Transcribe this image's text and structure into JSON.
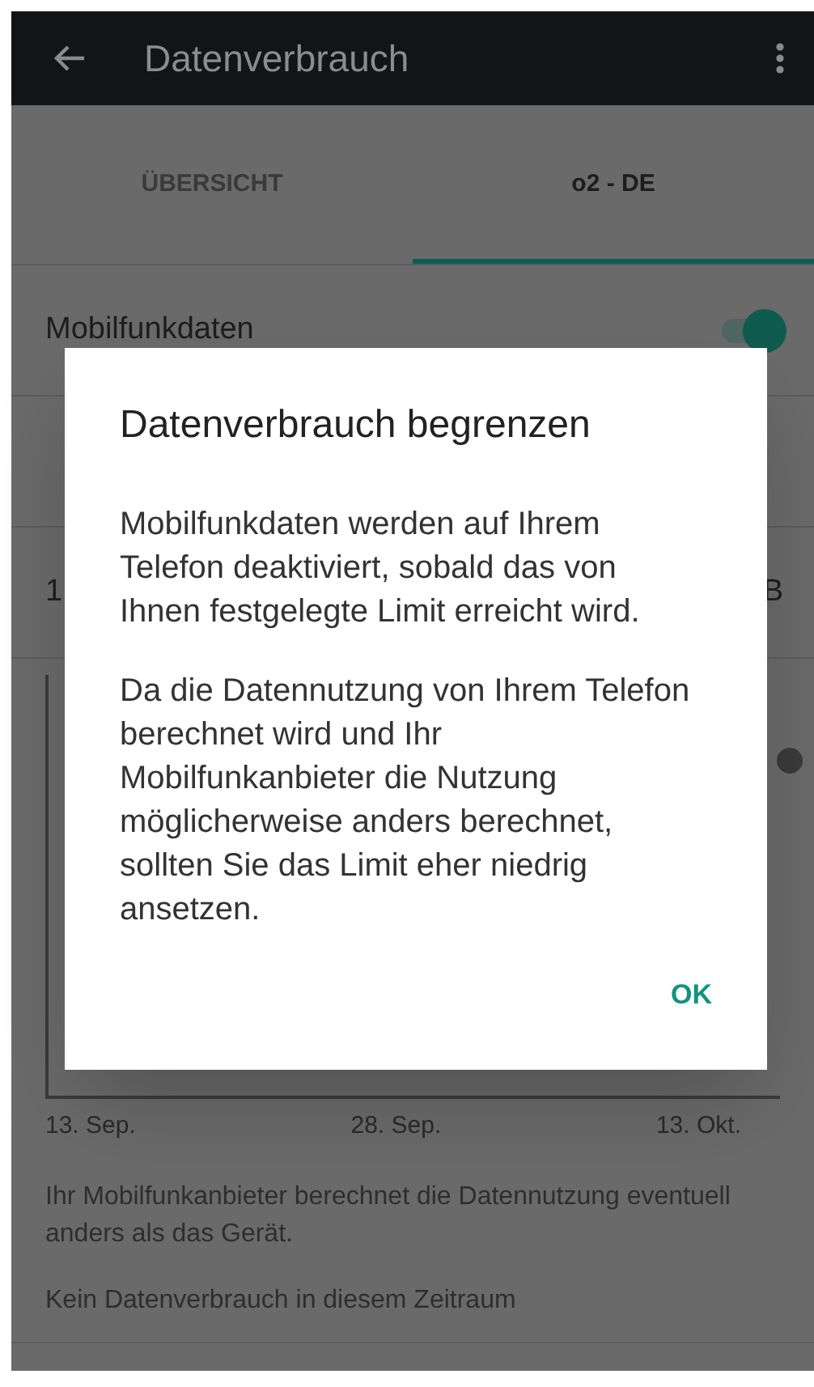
{
  "app_bar": {
    "title": "Datenverbrauch"
  },
  "tabs": [
    {
      "label": "ÜBERSICHT",
      "selected": false
    },
    {
      "label": "o2 - DE",
      "selected": true
    }
  ],
  "settings": [
    {
      "kind": "toggle",
      "label": "Mobilfunkdaten",
      "on": true
    },
    {
      "kind": "blank"
    },
    {
      "kind": "range",
      "label": "1",
      "value": "B"
    }
  ],
  "chart_axis_labels": [
    "13. Sep.",
    "28. Sep.",
    "13. Okt."
  ],
  "notes": [
    "Ihr Mobilfunkanbieter berechnet die Datennutzung eventuell anders als das Gerät.",
    "Kein Datenverbrauch in diesem Zeitraum"
  ],
  "dialog": {
    "title": "Datenverbrauch begrenzen",
    "paragraphs": [
      "Mobilfunkdaten werden auf Ihrem Telefon deaktiviert, sobald das von Ihnen festgelegte Limit erreicht wird.",
      "Da die Datennutzung von Ihrem Telefon berechnet wird und Ihr Mobilfunkanbieter die Nutzung möglicherweise anders berechnet, sollten Sie das Limit eher niedrig ansetzen."
    ],
    "button": "OK"
  }
}
